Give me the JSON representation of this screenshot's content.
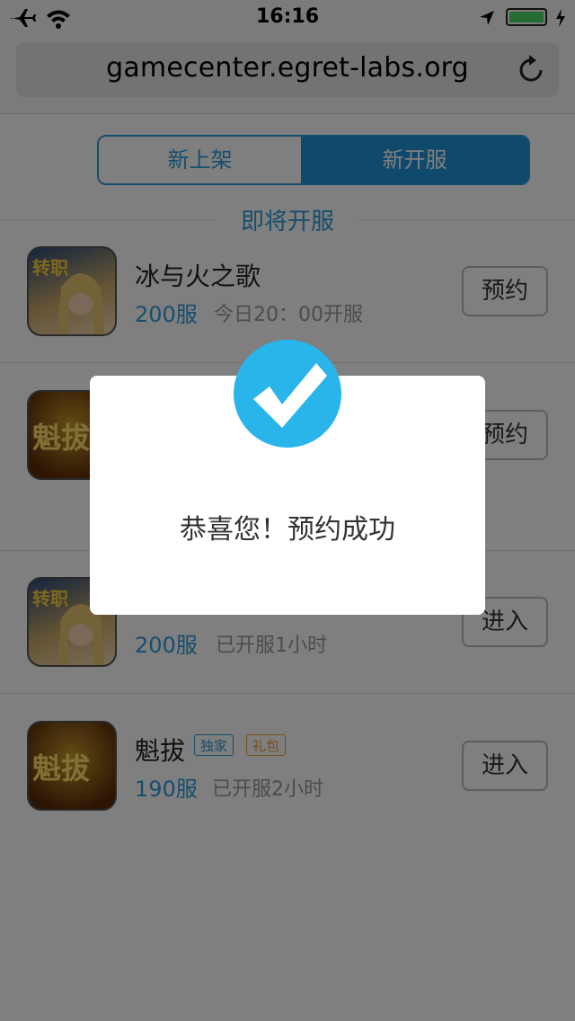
{
  "status_bar": {
    "time": "16:16",
    "icons": [
      "airplane-icon",
      "wifi-icon",
      "location-arrow-icon",
      "battery-icon",
      "charging-icon"
    ],
    "battery_color": "#4cd964"
  },
  "browser": {
    "url": "gamecenter.egret-labs.org",
    "reload_icon": "reload-icon"
  },
  "tabs": [
    {
      "label": "新上架",
      "active": false
    },
    {
      "label": "新开服",
      "active": true
    }
  ],
  "section_title": "即将开服",
  "games": [
    {
      "name": "冰与火之歌",
      "server": "200服",
      "time": "今日20：00开服",
      "button": "预约",
      "tags": []
    },
    {
      "name": "",
      "server": "",
      "time": "",
      "button": "预约",
      "tags": []
    },
    {
      "name": "",
      "server": "200服",
      "time": "已开服1小时",
      "button": "进入",
      "tags": []
    },
    {
      "name": "魁拔",
      "server": "190服",
      "time": "已开服2小时",
      "button": "进入",
      "tags": [
        "独家",
        "礼包"
      ]
    }
  ],
  "icon_overlay_text": {
    "zhuanzhi": "转职",
    "kuiba": "魁拔"
  },
  "modal": {
    "message": "恭喜您！预约成功",
    "icon": "check-icon",
    "icon_color": "#29b4ea"
  },
  "colors": {
    "accent": "#2d9cdb",
    "tag_exclusive": "#2d9cdb",
    "tag_gift": "#f0a030"
  }
}
